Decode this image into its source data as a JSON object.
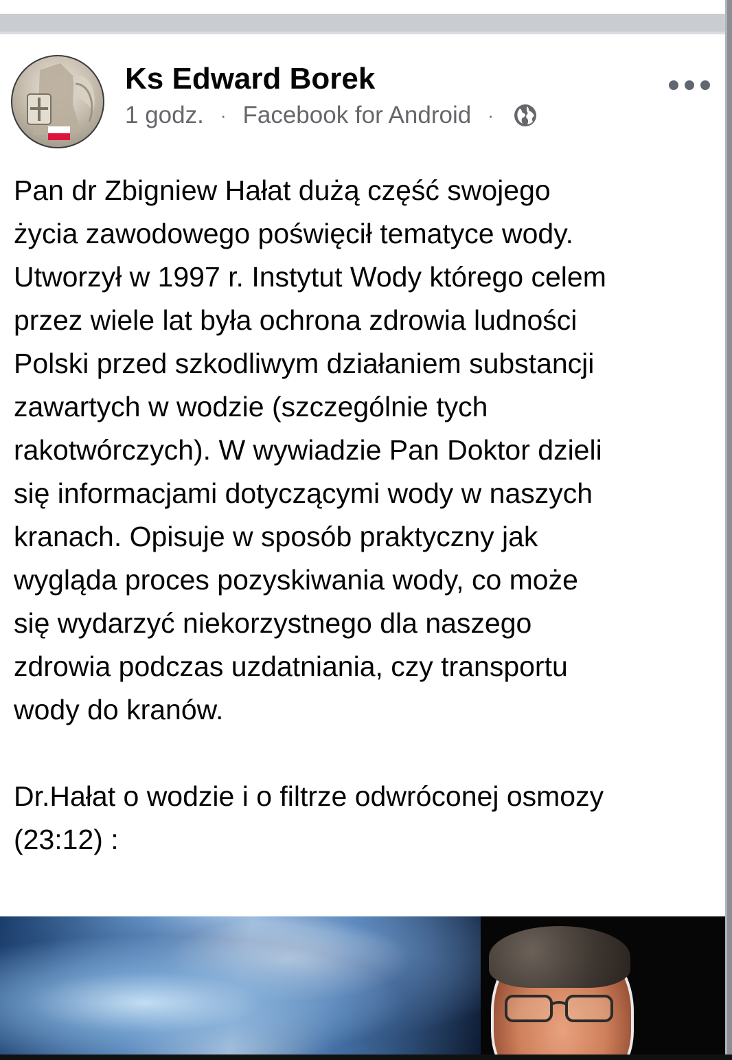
{
  "post": {
    "author": "Ks Edward Borek",
    "time": "1 godz.",
    "source": "Facebook for Android",
    "separator": "·",
    "privacy_icon": "globe-icon",
    "more_icon": "more-options-icon",
    "paragraphs": [
      "Pan dr Zbigniew Hałat dużą część swojego\nżycia zawodowego poświęcił tematyce wody.\nUtworzył w 1997 r. Instytut Wody którego celem\nprzez wiele lat była ochrona zdrowia ludności\nPolski przed szkodliwym działaniem substancji\nzawartych w wodzie (szczególnie tych\nrakotwórczych). W wywiadzie Pan Doktor dzieli\nsię informacjami dotyczącymi wody w naszych\nkranach. Opisuje w sposób praktyczny jak\nwygląda proces pozyskiwania wody, co może\nsię wydarzyć niekorzystnego dla naszego\nzdrowia podczas uzdatniania, czy transportu\nwody do kranów.",
      "Dr.Hałat o wodzie i o filtrze odwróconej osmozy\n(23:12) :"
    ]
  },
  "colors": {
    "secondary_text": "#65676b",
    "divider": "#c9ccd1",
    "author_text": "#050505"
  }
}
